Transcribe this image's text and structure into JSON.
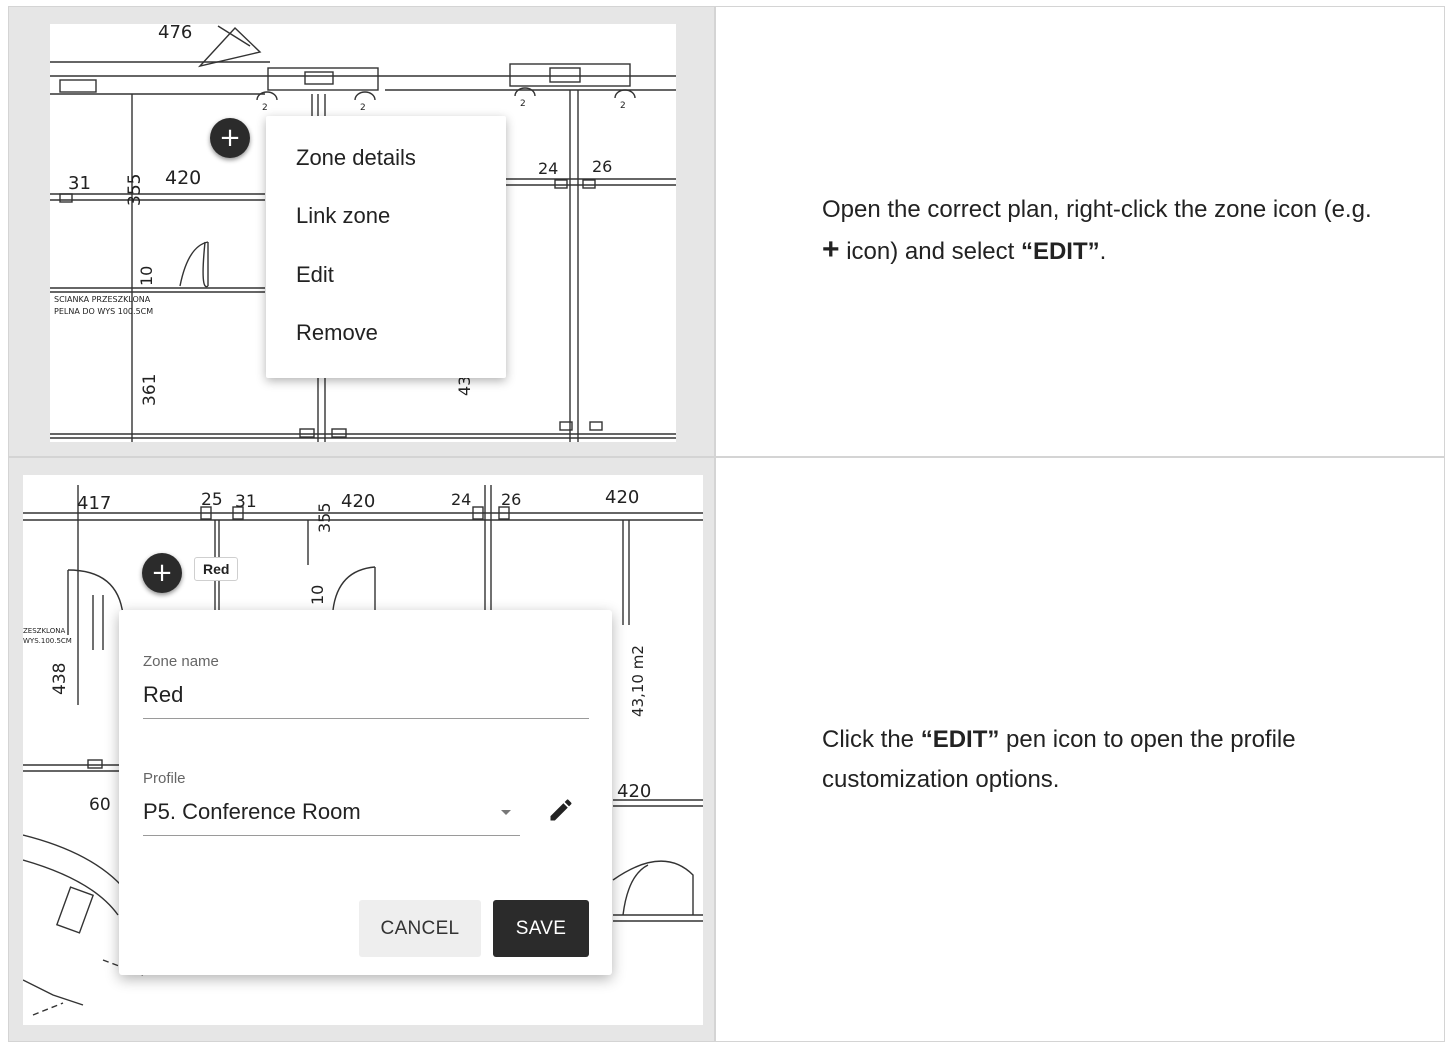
{
  "step1": {
    "plan_labels": [
      "476",
      "31",
      "420",
      "355",
      "24",
      "26",
      "10",
      "361",
      "43",
      "SCIANKA PRZESZKLONA",
      "PELNA DO WYS 100.5CM",
      "2",
      "2",
      "2",
      "2"
    ],
    "add_icon": "plus-icon",
    "context_menu": [
      "Zone details",
      "Link zone",
      "Edit",
      "Remove"
    ],
    "instruction": {
      "part1": "Open the correct plan, right-click the zone icon (e.g. ",
      "icon_symbol": "+",
      "part2": " icon) and select ",
      "emph": "“EDIT”",
      "part3": "."
    }
  },
  "step2": {
    "plan_labels": [
      "417",
      "25",
      "31",
      "355",
      "420",
      "24",
      "26",
      "420",
      "10",
      "438",
      "43,10 m2",
      "420",
      "60",
      "ZESZKLONA",
      "WYS.100.5CM"
    ],
    "zone_tag": "Red",
    "add_icon": "plus-icon",
    "dialog": {
      "zone_name_label": "Zone name",
      "zone_name_value": "Red",
      "profile_label": "Profile",
      "profile_value": "P5. Conference Room",
      "dropdown_icon": "caret-down-icon",
      "edit_icon": "pencil-icon",
      "cancel": "CANCEL",
      "save": "SAVE"
    },
    "instruction": {
      "part1": "Click the ",
      "emph": "“EDIT”",
      "part2": " pen icon to open the profile customization options."
    }
  },
  "colors": {
    "dark": "#2b2b2b",
    "border": "#d4d4d4",
    "shade": "#e6e6e6",
    "cancel_bg": "#eeeeee"
  }
}
